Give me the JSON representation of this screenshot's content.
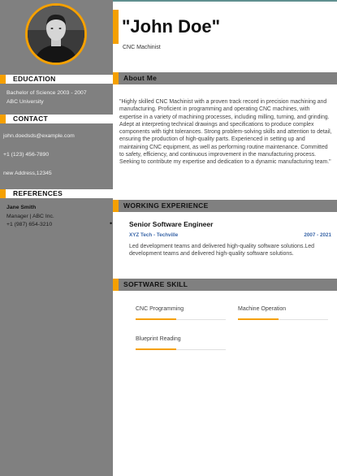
{
  "header": {
    "name": "\"John Doe\"",
    "job_title": "CNC Machinist"
  },
  "sidebar": {
    "education": {
      "heading": "EDUCATION",
      "degree": "Bachelor of Science 2003 - 2007",
      "school": "ABC University"
    },
    "contact": {
      "heading": "CONTACT",
      "email": "john.doedsds@example.com",
      "phone": "+1 (123) 456-7890",
      "address": "new Address,12345"
    },
    "references": {
      "heading": "REFERENCES",
      "name": "Jane Smith",
      "role": "Manager | ABC Inc.",
      "phone": "+1 (987) 654-3210"
    }
  },
  "about": {
    "heading": "About Me",
    "text": "\"Highly skilled CNC Machinist with a proven track record in precision machining and manufacturing. Proficient in programming and operating CNC machines, with expertise in a variety of machining processes, including milling, turning, and grinding. Adept at interpreting technical drawings and specifications to produce complex components with tight tolerances. Strong problem-solving skills and attention to detail, ensuring the production of high-quality parts. Experienced in setting up and maintaining CNC equipment, as well as performing routine maintenance. Committed to safety, efficiency, and continuous improvement in the manufacturing process. Seeking to contribute my expertise and dedication to a dynamic manufacturing team.\""
  },
  "experience": {
    "heading": "WORKING EXPERIENCE",
    "jobs": [
      {
        "title": "Senior Software Engineer",
        "company": "XYZ Tech - Techville",
        "dates": "2007 - 2021",
        "description": "Led development teams and delivered high-quality software solutions.Led development teams and delivered high-quality software solutions."
      }
    ]
  },
  "skills": {
    "heading": "SOFTWARE SKILL",
    "items": [
      {
        "name": "CNC Programming",
        "level": 0.45
      },
      {
        "name": "Machine Operation",
        "level": 0.45
      },
      {
        "name": "Blueprint Reading",
        "level": 0.45
      }
    ]
  },
  "colors": {
    "accent": "#f5a000",
    "sidebar": "#808080",
    "company": "#3a66a8"
  }
}
